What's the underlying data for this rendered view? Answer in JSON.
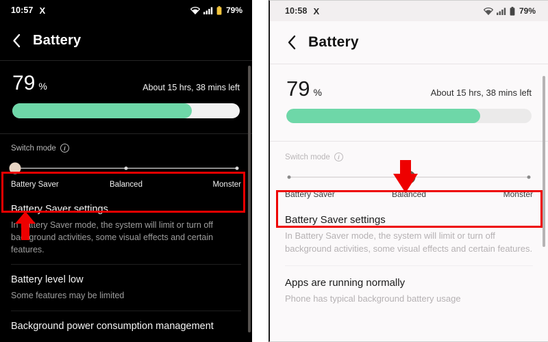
{
  "meta": {
    "accent_green": "#6ed7a8",
    "annotation_red": "#ee0000",
    "thumb_dark_panel": "#e8d5c4",
    "thumb_light_panel": "#6e5b4b"
  },
  "left_panel": {
    "theme": "dark",
    "statusbar": {
      "clock": "10:57",
      "app_glyph": "X",
      "wifi_icon": "wifi-icon",
      "signal_icon": "cellular-signal-icon",
      "battery_icon": "battery-icon",
      "battery_percent": "79%"
    },
    "appbar": {
      "back_icon": "back-chevron-icon",
      "title": "Battery"
    },
    "battery_card": {
      "percent_value": "79",
      "percent_sign": "%",
      "time_remaining": "About 15 hrs, 38 mins left",
      "fill_percent": 79
    },
    "switch_mode": {
      "label": "Switch mode",
      "info_icon": "info-icon",
      "selected_index": 0,
      "options": [
        "Battery Saver",
        "Balanced",
        "Monster"
      ]
    },
    "list_items": [
      {
        "title": "Battery Saver settings",
        "desc": "In Battery Saver mode, the system will limit or turn off background activities, some visual effects and certain features."
      },
      {
        "title": "Battery level low",
        "desc": "Some features may be limited"
      },
      {
        "title": "Background power consumption management",
        "desc": ""
      }
    ]
  },
  "right_panel": {
    "theme": "light",
    "statusbar": {
      "clock": "10:58",
      "app_glyph": "X",
      "wifi_icon": "wifi-icon",
      "signal_icon": "cellular-signal-icon",
      "battery_icon": "battery-icon",
      "battery_percent": "79%"
    },
    "appbar": {
      "back_icon": "back-chevron-icon",
      "title": "Battery"
    },
    "battery_card": {
      "percent_value": "79",
      "percent_sign": "%",
      "time_remaining": "About 15 hrs, 38 mins left",
      "fill_percent": 79
    },
    "switch_mode": {
      "label": "Switch mode",
      "info_icon": "info-icon",
      "selected_index": 1,
      "options": [
        "Battery Saver",
        "Balanced",
        "Monster"
      ]
    },
    "list_items": [
      {
        "title": "Battery Saver settings",
        "desc": "In Battery Saver mode, the system will limit or turn off background activities, some visual effects and certain features."
      },
      {
        "title": "Apps are running normally",
        "desc": "Phone has typical background battery usage"
      }
    ]
  },
  "annotations": {
    "left_highlight_box": "highlights the switch-mode slider row",
    "left_arrow_direction": "up",
    "right_highlight_box": "highlights the switch-mode slider row",
    "right_arrow_direction": "down"
  }
}
